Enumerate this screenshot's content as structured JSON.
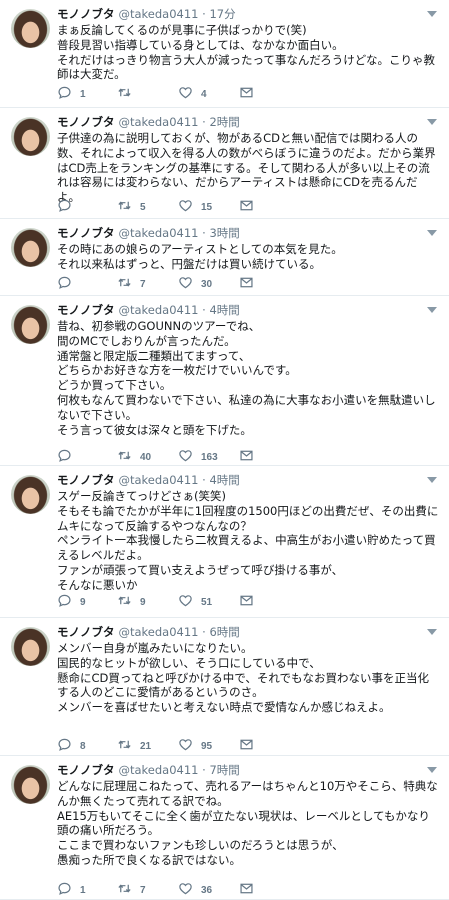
{
  "user": {
    "name": "モノノブタ",
    "handle": "@takeda0411"
  },
  "tweets": [
    {
      "time": "17分",
      "text": "まぁ反論してくるのが見事に子供ばっかりで(笑)\n普段見習い指導している身としては、なかなか面白い。\nそれだけはっきり物言う大人が減ったって事なんだろうけどな。こりゃ教師は大変だ。",
      "replies": "1",
      "retweets": "",
      "likes": "4"
    },
    {
      "time": "2時間",
      "text": "子供達の為に説明しておくが、物があるCDと無い配信では関わる人の数、それによって収入を得る人の数がべらぼうに違うのだよ。だから業界はCD売上をランキングの基準にする。そして関わる人が多い以上その流れは容易には変わらない、だからアーティストは懸命にCDを売るんだよ。",
      "replies": "",
      "retweets": "5",
      "likes": "15"
    },
    {
      "time": "3時間",
      "text": "その時にあの娘らのアーティストとしての本気を見た。\nそれ以来私はずっと、円盤だけは買い続けている。",
      "replies": "",
      "retweets": "7",
      "likes": "30"
    },
    {
      "time": "4時間",
      "text": "昔ね、初参戦のGOUNNのツアーでね、\n間のMCでしおりんが言ったんだ。\n通常盤と限定版二種類出てますって、\nどちらかお好きな方を一枚だけでいいんです。\nどうか買って下さい。\n何枚もなんて買わないで下さい、私達の為に大事なお小遣いを無駄遣いしないで下さい。\nそう言って彼女は深々と頭を下げた。",
      "replies": "",
      "retweets": "40",
      "likes": "163"
    },
    {
      "time": "4時間",
      "text": "スゲー反論きてっけどさぁ(笑笑)\nそもそも論でたかが半年に1回程度の1500円ほどの出費だぜ、その出費にムキになって反論するやつなんなの？\nペンライト一本我慢したら二枚買えるよ、中高生がお小遣い貯めたって買えるレベルだよ。\nファンが頑張って買い支えようぜって呼び掛ける事が、\nそんなに悪いか",
      "replies": "9",
      "retweets": "9",
      "likes": "51"
    },
    {
      "time": "6時間",
      "text": "メンバー自身が嵐みたいになりたい。\n国民的なヒットが欲しい、そう口にしている中で、\n懸命にCD買ってねと呼びかける中で、それでもなお買わない事を正当化する人のどこに愛情があるというのさ。\nメンバーを喜ばせたいと考えない時点で愛情なんか感じねえよ。",
      "replies": "8",
      "retweets": "21",
      "likes": "95"
    },
    {
      "time": "7時間",
      "text": "どんなに屁理屈こねたって、売れるアーはちゃんと10万やそこら、特典なんか無くたって売れてる訳でね。\nAE15万もいてそこに全く歯が立たない現状は、レーベルとしてもかなり頭の痛い所だろう。\nここまで買わないファンも珍しいのだろうとは思うが、\n愚痴った所で良くなる訳ではない。",
      "replies": "1",
      "retweets": "7",
      "likes": "36"
    }
  ]
}
